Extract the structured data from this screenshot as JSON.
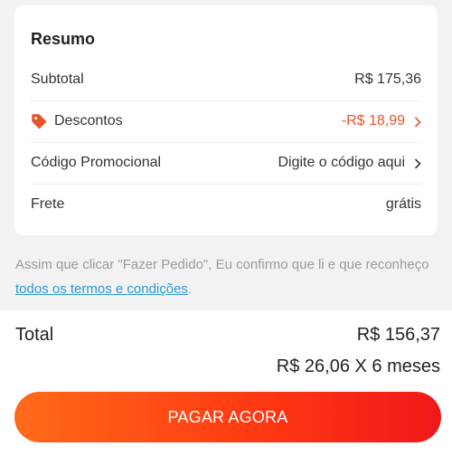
{
  "summary": {
    "title": "Resumo",
    "rows": [
      {
        "label": "Subtotal",
        "value": "R$ 175,36"
      },
      {
        "label": "Descontos",
        "value": "-R$ 18,99"
      },
      {
        "label": "Código Promocional",
        "value": "Digite o código aqui"
      },
      {
        "label": "Frete",
        "value": "grátis"
      }
    ]
  },
  "terms": {
    "text": "Assim que clicar \"Fazer Pedido\", Eu confirmo que li e que reconheço ",
    "link": "todos os termos e condições",
    "suffix": "."
  },
  "checkout": {
    "total_label": "Total",
    "total_value": "R$ 156,37",
    "installments": "R$ 26,06 X 6 meses",
    "pay_button": "PAGAR AGORA"
  },
  "colors": {
    "discount": "#e8532a",
    "link": "#2a9ad6",
    "button_gradient_start": "#ff6a1a",
    "button_gradient_end": "#f0181a"
  },
  "icons": {
    "discount": "tag-icon",
    "row_arrow": "chevron-right-icon"
  }
}
